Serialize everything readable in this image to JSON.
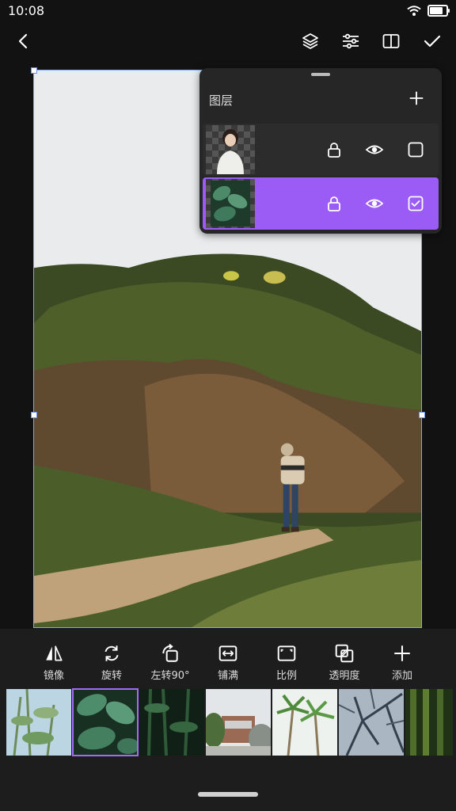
{
  "status": {
    "time": "10:08",
    "battery_level": 0.9
  },
  "toolbar": {
    "icons": [
      "back-icon",
      "layers-icon",
      "adjust-icon",
      "compare-icon",
      "confirm-icon"
    ]
  },
  "layer_panel": {
    "title": "图层",
    "layers": [
      {
        "locked": false,
        "visible": true,
        "selected": false
      },
      {
        "locked": false,
        "visible": true,
        "selected": true
      }
    ],
    "accent_color": "#9b5cf5"
  },
  "tools": [
    {
      "label": "镜像",
      "icon": "mirror-icon"
    },
    {
      "label": "旋转",
      "icon": "rotate-icon"
    },
    {
      "label": "左转90°",
      "icon": "rotate-left-icon"
    },
    {
      "label": "铺满",
      "icon": "fill-icon"
    },
    {
      "label": "比例",
      "icon": "ratio-icon"
    },
    {
      "label": "透明度",
      "icon": "opacity-icon"
    },
    {
      "label": "添加",
      "icon": "plus-icon"
    }
  ],
  "backgrounds": {
    "selected_index": 1,
    "items": [
      "bamboo",
      "monstera-leaves",
      "dark-bamboo",
      "white-building",
      "palm-trees",
      "bare-tree",
      "green-bamboo"
    ]
  }
}
